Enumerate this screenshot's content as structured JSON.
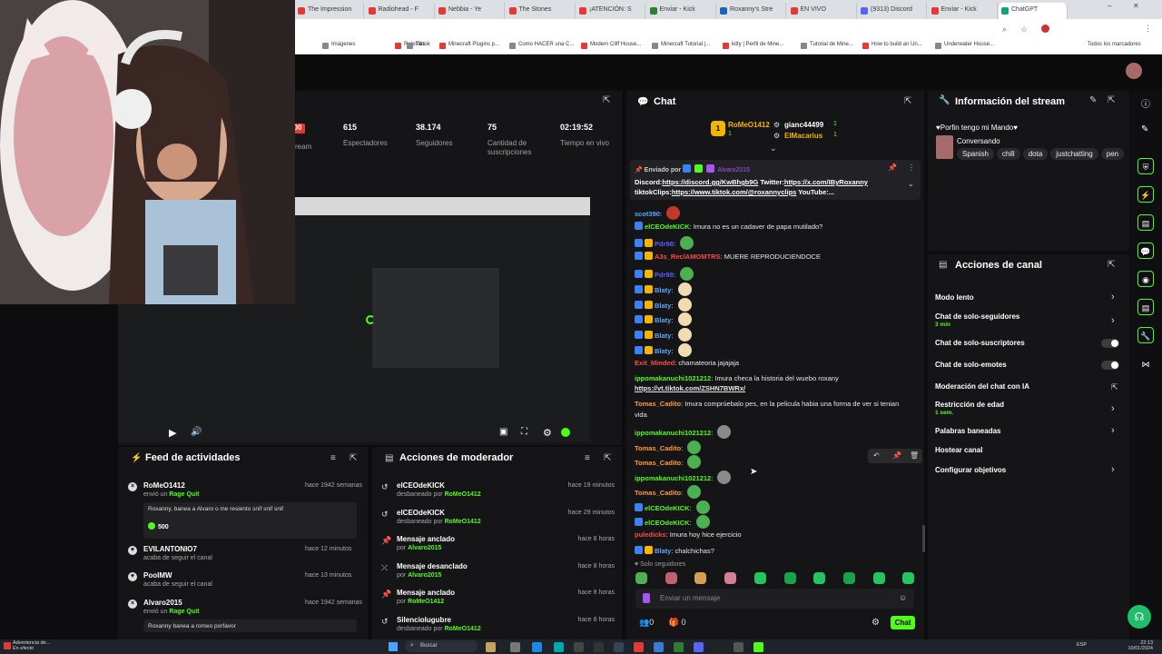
{
  "browser": {
    "tabs": [
      {
        "label": "The Impression",
        "color": "#e53935"
      },
      {
        "label": "Radiohead - F",
        "color": "#e53935"
      },
      {
        "label": "Nebbia - Ye",
        "color": "#e53935"
      },
      {
        "label": "The Stones",
        "color": "#e53935"
      },
      {
        "label": "¡ATENCIÓN: S",
        "color": "#e53935"
      },
      {
        "label": "Enviar - Kick",
        "color": "#2e7d32"
      },
      {
        "label": "Roxanny's Stre",
        "color": "#1565c0"
      },
      {
        "label": "EN VIVO",
        "color": "#e53935"
      },
      {
        "label": "(9313) Discord",
        "color": "#5865f2"
      },
      {
        "label": "Enviar - Kick",
        "color": "#e53935"
      },
      {
        "label": "ChatGPT",
        "color": "#10a37f"
      }
    ],
    "bookmarks": [
      "Imágenes",
      "Ruletitas",
      "Tiktok",
      "Minecraft Plugins p...",
      "Como HACER una C...",
      "Modern Cliff House...",
      "Minecraft Tutorial |...",
      "kitty | Perfil de Mine...",
      "Tutorial de Mine...",
      "How to build an Un...",
      "Underwater House..."
    ],
    "bookmarks_all": "Todos los marcadores"
  },
  "stats": {
    "stream_word": "ream",
    "items": [
      {
        "value": "615",
        "label": "Espectadores"
      },
      {
        "value": "38.174",
        "label": "Seguidores"
      },
      {
        "value": "75",
        "label": "Cantidad de suscripciones"
      },
      {
        "value": "02:19:52",
        "label": "Tiempo en vivo"
      }
    ],
    "live_badge": "00"
  },
  "chat": {
    "title": "Chat",
    "top_gifters": [
      {
        "rank": "1",
        "name": "RoMeO1412",
        "count": "1"
      },
      {
        "rank": "",
        "name": "gianc44499",
        "count": "1"
      },
      {
        "rank": "",
        "name": "ElMacarius",
        "count": "1"
      }
    ],
    "pinned": {
      "by_label": "Enviado por",
      "by_user": "Alvaro2015",
      "line1_prefix": "Discord:",
      "line1_link": "https://discord.gg/KwBhgb9G",
      "line1_mid": " Twitter:",
      "line1_link2": "https://x.com/IByRoxanny",
      "line2_prefix": "tiktokClips:",
      "line2_link": "https://www.tiktok.com/@roxannyclips",
      "line2_tail": " YouTube:..."
    },
    "messages": [
      {
        "user": "scot390",
        "color": "#5aa7ff",
        "text": "",
        "emote": "#c0392b"
      },
      {
        "user": "elCEOdeKICK",
        "color": "#53fc18",
        "text": "Imura no es un cadaver de papa mutilado?",
        "emote": ""
      },
      {
        "user": "Pdr98",
        "color": "#5a5aff",
        "text": "",
        "emote": "#4caf50"
      },
      {
        "user": "A3s_ReclAMOMTRS",
        "color": "#ff4a4a",
        "text": "MUERE REPRODUCIENDOCE",
        "emote": ""
      },
      {
        "user": "Pdr98",
        "color": "#5a5aff",
        "text": "",
        "emote": "#4caf50"
      },
      {
        "user": "Blaty",
        "color": "#5aa7ff",
        "text": "",
        "emote": "#f0dcb0"
      },
      {
        "user": "Blaty",
        "color": "#5aa7ff",
        "text": "",
        "emote": "#f0dcb0"
      },
      {
        "user": "Blaty",
        "color": "#5aa7ff",
        "text": "",
        "emote": "#f0dcb0"
      },
      {
        "user": "Blaty",
        "color": "#5aa7ff",
        "text": "",
        "emote": "#f0dcb0"
      },
      {
        "user": "Blaty",
        "color": "#5aa7ff",
        "text": "",
        "emote": "#f0dcb0"
      },
      {
        "user": "Exit_Minded",
        "color": "#ff4a4a",
        "text": "chamateoria jajajaja",
        "emote": ""
      },
      {
        "user": "ippomakanuchi1021212",
        "color": "#53fc18",
        "text": "Imura checa la historia del wuebo roxany",
        "emote": ""
      },
      {
        "user": "",
        "color": "#fff",
        "text": "https://vt.tiktok.com/ZSHN7BWRx/",
        "emote": ""
      },
      {
        "user": "Tomas_Cadito",
        "color": "#ff9a3c",
        "text": "Imura comprúebalo pes, en la pelicula habia una forma de ver si tenian",
        "emote": ""
      },
      {
        "user": "",
        "color": "#fff",
        "text": "vida",
        "emote": ""
      },
      {
        "user": "ippomakanuchi1021212",
        "color": "#53fc18",
        "text": "",
        "emote": "#8a8a8a"
      },
      {
        "user": "Tomas_Cadito",
        "color": "#ff9a3c",
        "text": "",
        "emote": "#4caf50"
      },
      {
        "user": "Tomas_Cadito",
        "color": "#ff9a3c",
        "text": "",
        "emote": "#4caf50"
      },
      {
        "user": "ippomakanuchi1021212",
        "color": "#53fc18",
        "text": "",
        "emote": "#8a8a8a"
      },
      {
        "user": "Tomas_Cadito",
        "color": "#ff9a3c",
        "text": "",
        "emote": "#4caf50"
      },
      {
        "user": "elCEOdeKICK",
        "color": "#53fc18",
        "text": "",
        "emote": "#4caf50"
      },
      {
        "user": "elCEOdeKICK",
        "color": "#53fc18",
        "text": "",
        "emote": "#4caf50"
      },
      {
        "user": "puledicks",
        "color": "#ff4a4a",
        "text": "Imura hoy hice ejercicio",
        "emote": ""
      },
      {
        "user": "Blaty",
        "color": "#5aa7ff",
        "text": "chalchichas?",
        "emote": ""
      }
    ],
    "mode_label": "Solo seguidores",
    "input_placeholder": "Enviar un mensaje",
    "footer_count1": "0",
    "footer_count2": "0",
    "send_label": "Chat"
  },
  "feed": {
    "title": "Feed de actividades",
    "items": [
      {
        "name": "RoMeO1412",
        "sub_prefix": "envió un",
        "sub_link": "Rage Quit",
        "time": "hace 1942 semanas",
        "quote": "Roxanny, banea a Alvaro o me resiento snif snif snif",
        "amount": "500"
      },
      {
        "name": "EVILANTONIO7",
        "sub_prefix": "acaba de seguir el canal",
        "sub_link": "",
        "time": "hace 12 minutos",
        "quote": "",
        "amount": ""
      },
      {
        "name": "PoolMW",
        "sub_prefix": "acaba de seguir el canal",
        "sub_link": "",
        "time": "hace 13 minutos",
        "quote": "",
        "amount": ""
      },
      {
        "name": "Alvaro2015",
        "sub_prefix": "envió un",
        "sub_link": "Rage Quit",
        "time": "hace 1942 semanas",
        "quote": "Roxanny banea a romeo porfavor",
        "amount": ""
      }
    ]
  },
  "mod": {
    "title": "Acciones de moderador",
    "items": [
      {
        "name": "elCEOdeKICK",
        "sub": "desbaneado por",
        "by": "RoMeO1412",
        "time": "hace 19 minutos"
      },
      {
        "name": "elCEOdeKICK",
        "sub": "desbaneado por",
        "by": "RoMeO1412",
        "time": "hace 29 minutos"
      },
      {
        "name": "Mensaje anclado",
        "sub": "por",
        "by": "Alvaro2015",
        "time": "hace 8 horas"
      },
      {
        "name": "Mensaje desanclado",
        "sub": "por",
        "by": "Alvaro2015",
        "time": "hace 8 horas"
      },
      {
        "name": "Mensaje anclado",
        "sub": "por",
        "by": "RoMeO1412",
        "time": "hace 8 horas"
      },
      {
        "name": "Silenciolugubre",
        "sub": "desbaneado por",
        "by": "RoMeO1412",
        "time": "hace 8 horas"
      }
    ]
  },
  "info": {
    "title": "Información del stream",
    "stream_title": "♥Porfin tengo mi Mando♥",
    "category": "Conversando",
    "tags": [
      "Spanish",
      "chill",
      "dota",
      "justchatting",
      "pen"
    ]
  },
  "actions": {
    "title": "Acciones de canal",
    "items": [
      {
        "label": "Modo lento",
        "sub": "",
        "ctrl": "chev"
      },
      {
        "label": "Chat de solo-seguidores",
        "sub": "3 min",
        "ctrl": "chev"
      },
      {
        "label": "Chat de solo-suscriptores",
        "sub": "",
        "ctrl": "toggle"
      },
      {
        "label": "Chat de solo-emotes",
        "sub": "",
        "ctrl": "toggle"
      },
      {
        "label": "Moderación del chat con IA",
        "sub": "",
        "ctrl": "ext"
      },
      {
        "label": "Restricción de edad",
        "sub": "1 sem.",
        "ctrl": "chev"
      },
      {
        "label": "Palabras baneadas",
        "sub": "",
        "ctrl": "chev"
      },
      {
        "label": "Hostear canal",
        "sub": "",
        "ctrl": ""
      },
      {
        "label": "Configurar objetivos",
        "sub": "",
        "ctrl": "chev"
      }
    ]
  },
  "taskbar": {
    "warning_title": "Advertencia de...",
    "warning_sub": "En efecto",
    "search": "Buscar",
    "lang": "ESP",
    "time": "22:13",
    "date": "10/01/2024"
  },
  "colors": {
    "accent": "#53fc18",
    "panel": "#151517",
    "bg": "#0d0d0f"
  }
}
